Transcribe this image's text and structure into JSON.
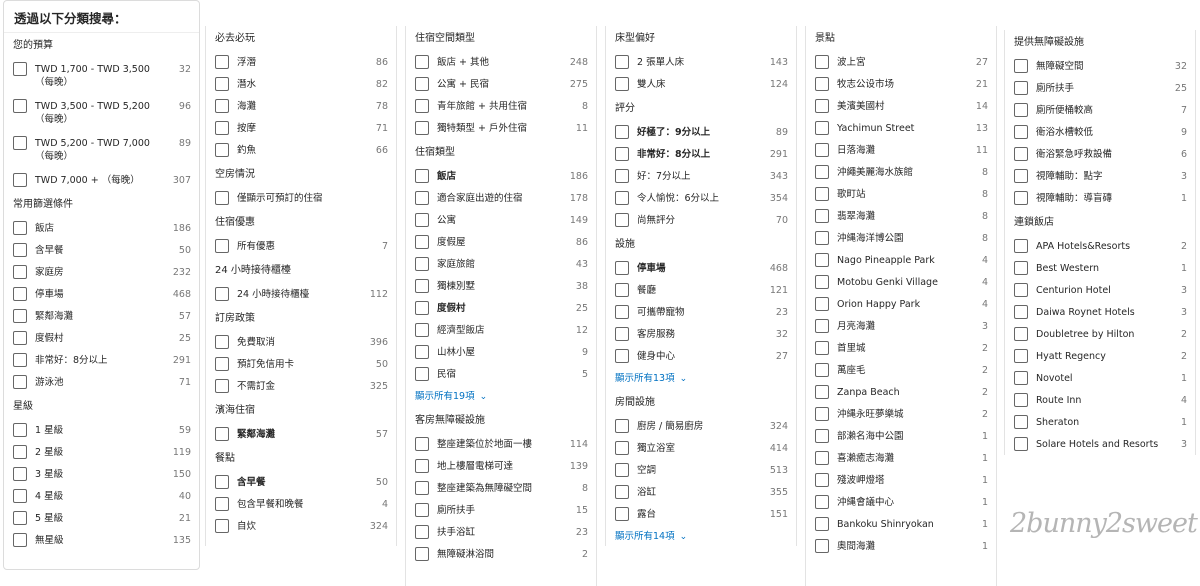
{
  "title": "透過以下分類搜尋：",
  "columns": [
    {
      "sections": [
        {
          "header": "您的預算",
          "items": [
            {
              "label": "TWD 1,700 - TWD 3,500 （每晚）",
              "count": "32",
              "tall": true
            },
            {
              "label": "TWD 3,500 - TWD 5,200 （每晚）",
              "count": "96",
              "tall": true
            },
            {
              "label": "TWD 5,200 - TWD 7,000 （每晚）",
              "count": "89",
              "tall": true
            },
            {
              "label": "TWD 7,000 + （每晚）",
              "count": "307"
            }
          ]
        },
        {
          "header": "常用篩選條件",
          "items": [
            {
              "label": "飯店",
              "count": "186"
            },
            {
              "label": "含早餐",
              "count": "50"
            },
            {
              "label": "家庭房",
              "count": "232"
            },
            {
              "label": "停車場",
              "count": "468"
            },
            {
              "label": "緊鄰海灘",
              "count": "57"
            },
            {
              "label": "度假村",
              "count": "25"
            },
            {
              "label": "非常好：8分以上",
              "count": "291"
            },
            {
              "label": "游泳池",
              "count": "71"
            }
          ]
        },
        {
          "header": "星級",
          "items": [
            {
              "label": "1 星級",
              "count": "59"
            },
            {
              "label": "2 星級",
              "count": "119"
            },
            {
              "label": "3 星級",
              "count": "150"
            },
            {
              "label": "4 星級",
              "count": "40"
            },
            {
              "label": "5 星級",
              "count": "21"
            },
            {
              "label": "無星級",
              "count": "135"
            }
          ]
        }
      ]
    },
    {
      "sections": [
        {
          "header": "必去必玩",
          "items": [
            {
              "label": "浮潛",
              "count": "86"
            },
            {
              "label": "潛水",
              "count": "82"
            },
            {
              "label": "海灘",
              "count": "78"
            },
            {
              "label": "按摩",
              "count": "71"
            },
            {
              "label": "釣魚",
              "count": "66"
            }
          ]
        },
        {
          "header": "空房情況",
          "items": [
            {
              "label": "僅顯示可預訂的住宿",
              "count": ""
            }
          ]
        },
        {
          "header": "住宿優惠",
          "items": [
            {
              "label": "所有優惠",
              "count": "7"
            }
          ]
        },
        {
          "header": "24 小時接待櫃檯",
          "items": [
            {
              "label": "24 小時接待櫃檯",
              "count": "112"
            }
          ]
        },
        {
          "header": "訂房政策",
          "items": [
            {
              "label": "免費取消",
              "count": "396"
            },
            {
              "label": "預訂免信用卡",
              "count": "50"
            },
            {
              "label": "不需訂金",
              "count": "325"
            }
          ]
        },
        {
          "header": "濱海住宿",
          "items": [
            {
              "label": "緊鄰海灘",
              "count": "57",
              "bold": true
            }
          ]
        },
        {
          "header": "餐點",
          "items": [
            {
              "label": "含早餐",
              "count": "50",
              "bold": true
            },
            {
              "label": "包含早餐和晚餐",
              "count": "4"
            },
            {
              "label": "自炊",
              "count": "324"
            }
          ]
        }
      ]
    },
    {
      "sections": [
        {
          "header": "住宿空間類型",
          "items": [
            {
              "label": "飯店 + 其他",
              "count": "248"
            },
            {
              "label": "公寓 + 民宿",
              "count": "275"
            },
            {
              "label": "青年旅館 + 共用住宿",
              "count": "8"
            },
            {
              "label": "獨特類型 + 戶外住宿",
              "count": "11"
            }
          ]
        },
        {
          "header": "住宿類型",
          "items": [
            {
              "label": "飯店",
              "count": "186",
              "bold": true
            },
            {
              "label": "適合家庭出遊的住宿",
              "count": "178"
            },
            {
              "label": "公寓",
              "count": "149"
            },
            {
              "label": "度假屋",
              "count": "86"
            },
            {
              "label": "家庭旅館",
              "count": "43"
            },
            {
              "label": "獨棟別墅",
              "count": "38"
            },
            {
              "label": "度假村",
              "count": "25",
              "bold": true
            },
            {
              "label": "經濟型飯店",
              "count": "12"
            },
            {
              "label": "山林小屋",
              "count": "9"
            },
            {
              "label": "民宿",
              "count": "5"
            }
          ],
          "show_all": "顯示所有19項"
        },
        {
          "header": "客房無障礙設施",
          "items": [
            {
              "label": "整座建築位於地面一樓",
              "count": "114"
            },
            {
              "label": "地上樓層電梯可達",
              "count": "139"
            },
            {
              "label": "整座建築為無障礙空間",
              "count": "8"
            },
            {
              "label": "廁所扶手",
              "count": "15"
            },
            {
              "label": "扶手浴缸",
              "count": "23"
            },
            {
              "label": "無障礙淋浴間",
              "count": "2"
            }
          ]
        }
      ]
    },
    {
      "sections": [
        {
          "header": "床型偏好",
          "items": [
            {
              "label": "2 張單人床",
              "count": "143"
            },
            {
              "label": "雙人床",
              "count": "124"
            }
          ]
        },
        {
          "header": "評分",
          "items": [
            {
              "label": "好極了：9分以上",
              "count": "89",
              "bold": true
            },
            {
              "label": "非常好：8分以上",
              "count": "291",
              "bold": true
            },
            {
              "label": "好：7分以上",
              "count": "343"
            },
            {
              "label": "令人愉悅：6分以上",
              "count": "354"
            },
            {
              "label": "尚無評分",
              "count": "70"
            }
          ]
        },
        {
          "header": "設施",
          "items": [
            {
              "label": "停車場",
              "count": "468",
              "bold": true
            },
            {
              "label": "餐廳",
              "count": "121"
            },
            {
              "label": "可攜帶寵物",
              "count": "23"
            },
            {
              "label": "客房服務",
              "count": "32"
            },
            {
              "label": "健身中心",
              "count": "27"
            }
          ],
          "show_all": "顯示所有13項"
        },
        {
          "header": "房間設施",
          "items": [
            {
              "label": "廚房 / 簡易廚房",
              "count": "324"
            },
            {
              "label": "獨立浴室",
              "count": "414"
            },
            {
              "label": "空調",
              "count": "513"
            },
            {
              "label": "浴缸",
              "count": "355"
            },
            {
              "label": "露台",
              "count": "151"
            }
          ],
          "show_all": "顯示所有14項"
        }
      ]
    },
    {
      "sections": [
        {
          "header": "景點",
          "items": [
            {
              "label": "波上宮",
              "count": "27"
            },
            {
              "label": "牧志公设市场",
              "count": "21"
            },
            {
              "label": "美濱美國村",
              "count": "14"
            },
            {
              "label": "Yachimun Street",
              "count": "13"
            },
            {
              "label": "日落海灘",
              "count": "11"
            },
            {
              "label": "沖繩美麗海水族館",
              "count": "8"
            },
            {
              "label": "歌町站",
              "count": "8"
            },
            {
              "label": "翡翠海灘",
              "count": "8"
            },
            {
              "label": "沖縄海洋博公園",
              "count": "8"
            },
            {
              "label": "Nago Pineapple Park",
              "count": "4"
            },
            {
              "label": "Motobu Genki Village",
              "count": "4"
            },
            {
              "label": "Orion Happy Park",
              "count": "4"
            },
            {
              "label": "月亮海灘",
              "count": "3"
            },
            {
              "label": "首里城",
              "count": "2"
            },
            {
              "label": "萬座毛",
              "count": "2"
            },
            {
              "label": "Zanpa Beach",
              "count": "2"
            },
            {
              "label": "沖縄永旺夢樂城",
              "count": "2"
            },
            {
              "label": "部瀨名海中公園",
              "count": "1"
            },
            {
              "label": "喜瀨癒志海灘",
              "count": "1"
            },
            {
              "label": "殘波岬燈塔",
              "count": "1"
            },
            {
              "label": "沖縄會議中心",
              "count": "1"
            },
            {
              "label": "Bankoku Shinryokan",
              "count": "1"
            },
            {
              "label": "奧間海灘",
              "count": "1"
            }
          ]
        }
      ]
    },
    {
      "sections": [
        {
          "header": "提供無障礙設施",
          "items": [
            {
              "label": "無障礙空間",
              "count": "32"
            },
            {
              "label": "廁所扶手",
              "count": "25"
            },
            {
              "label": "廁所便桶較高",
              "count": "7"
            },
            {
              "label": "衛浴水槽較低",
              "count": "9"
            },
            {
              "label": "衛浴緊急呼救設備",
              "count": "6"
            },
            {
              "label": "視障輔助：點字",
              "count": "3"
            },
            {
              "label": "視障輔助：導盲磚",
              "count": "1"
            }
          ]
        },
        {
          "header": "連鎖飯店",
          "items": [
            {
              "label": "APA Hotels&Resorts",
              "count": "2"
            },
            {
              "label": "Best Western",
              "count": "1"
            },
            {
              "label": "Centurion Hotel",
              "count": "3"
            },
            {
              "label": "Daiwa Roynet Hotels",
              "count": "3"
            },
            {
              "label": "Doubletree by Hilton",
              "count": "2"
            },
            {
              "label": "Hyatt Regency",
              "count": "2"
            },
            {
              "label": "Novotel",
              "count": "1"
            },
            {
              "label": "Route Inn",
              "count": "4"
            },
            {
              "label": "Sheraton",
              "count": "1"
            },
            {
              "label": "Solare Hotels and Resorts",
              "count": "3"
            }
          ]
        }
      ]
    }
  ],
  "watermark": "2bunny2sweet",
  "colors": {
    "link": "#0071c2",
    "count": "#777777",
    "border": "#e3e3e3"
  }
}
